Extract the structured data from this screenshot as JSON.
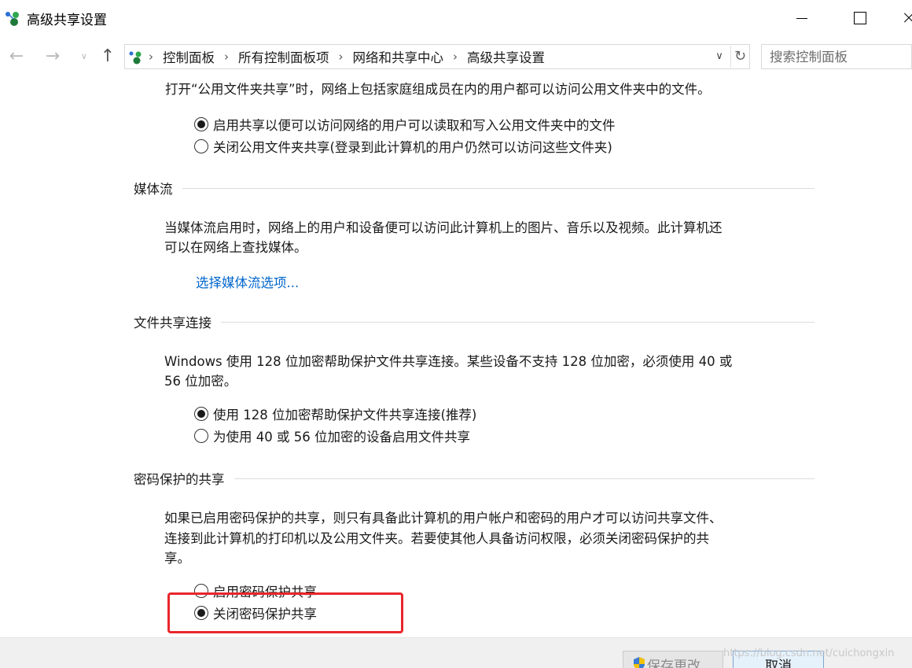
{
  "window": {
    "title": "高级共享设置"
  },
  "nav": {
    "back_icon": "arrow-left-icon",
    "forward_icon": "arrow-right-icon",
    "up_icon": "arrow-up-icon"
  },
  "address": {
    "breadcrumbs": [
      "控制面板",
      "所有控制面板项",
      "网络和共享中心",
      "高级共享设置"
    ]
  },
  "search": {
    "placeholder": "搜索控制面板"
  },
  "public_folder": {
    "description": "打开“公用文件夹共享”时，网络上包括家庭组成员在内的用户都可以访问公用文件夹中的文件。",
    "options": [
      {
        "label": "启用共享以便可以访问网络的用户可以读取和写入公用文件夹中的文件",
        "checked": true
      },
      {
        "label": "关闭公用文件夹共享(登录到此计算机的用户仍然可以访问这些文件夹)",
        "checked": false
      }
    ]
  },
  "media_streaming": {
    "title": "媒体流",
    "description_line1": "当媒体流启用时，网络上的用户和设备便可以访问此计算机上的图片、音乐以及视频。此计算机还",
    "description_line2": "可以在网络上查找媒体。",
    "link": "选择媒体流选项..."
  },
  "file_sharing": {
    "title": "文件共享连接",
    "description_line1": "Windows 使用 128 位加密帮助保护文件共享连接。某些设备不支持 128 位加密，必须使用 40 或",
    "description_line2": "56 位加密。",
    "options": [
      {
        "label": "使用 128 位加密帮助保护文件共享连接(推荐)",
        "checked": true
      },
      {
        "label": "为使用 40 或 56 位加密的设备启用文件共享",
        "checked": false
      }
    ]
  },
  "password_sharing": {
    "title": "密码保护的共享",
    "description_line1": "如果已启用密码保护的共享，则只有具备此计算机的用户帐户和密码的用户才可以访问共享文件、",
    "description_line2": "连接到此计算机的打印机以及公用文件夹。若要使其他人具备访问权限，必须关闭密码保护的共",
    "description_line3": "享。",
    "options": [
      {
        "label": "启用密码保护共享",
        "checked": false
      },
      {
        "label": "关闭密码保护共享",
        "checked": true
      }
    ],
    "highlight_color": "#e8262b"
  },
  "footer": {
    "save_label": "保存更改",
    "cancel_label": "取消",
    "watermark": "https://blog.csdn.net/cuichongxin"
  }
}
